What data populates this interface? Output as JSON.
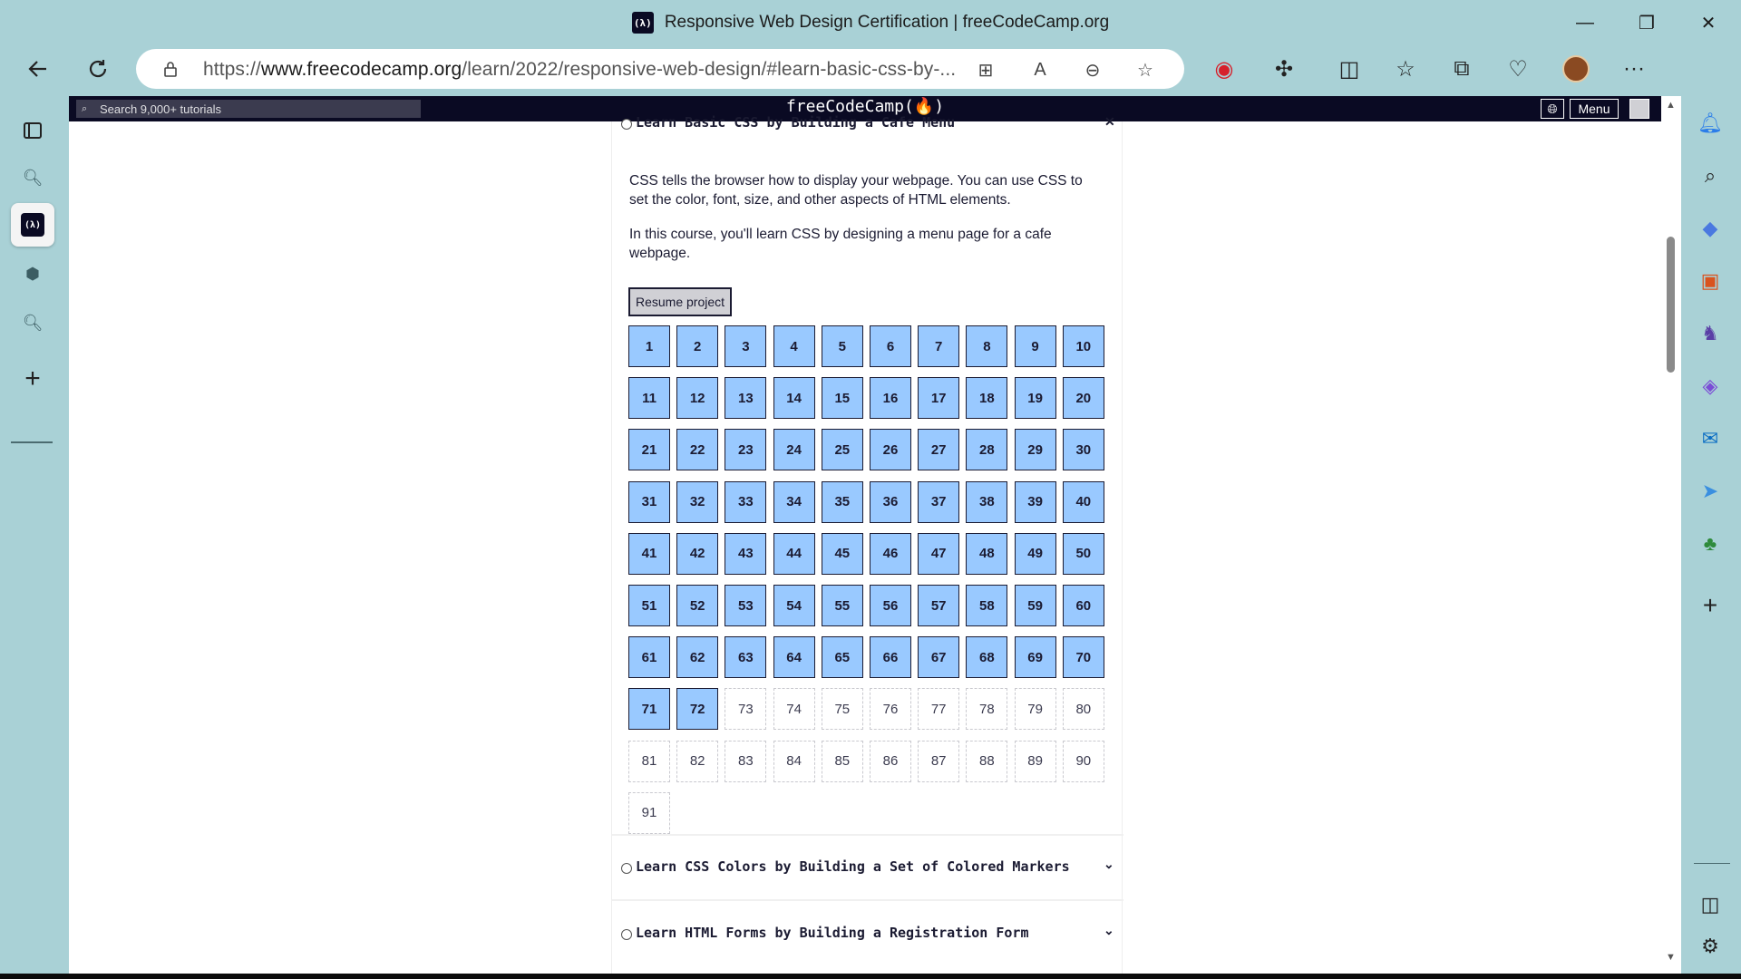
{
  "window": {
    "tab_logo": "(λ)",
    "title": "Responsive Web Design Certification | freeCodeCamp.org"
  },
  "address_bar": {
    "url_prefix": "https://",
    "url_domain": "www.freecodecamp.org",
    "url_path": "/learn/2022/responsive-web-design/#learn-basic-css-by-..."
  },
  "fcc_nav": {
    "search_placeholder": "Search 9,000+ tutorials",
    "brand": "freeCodeCamp(🔥)",
    "menu_label": "Menu"
  },
  "course": {
    "title": "Learn Basic CSS by Building a Cafe Menu",
    "description_1": "CSS tells the browser how to display your webpage. You can use CSS to set the color, font, size, and other aspects of HTML elements.",
    "description_2": "In this course, you'll learn CSS by designing a menu page for a cafe webpage.",
    "resume_label": "Resume project",
    "total_steps": 91,
    "completed_steps": 72
  },
  "next_blocks": [
    {
      "title": "Learn CSS Colors by Building a Set of Colored Markers"
    },
    {
      "title": "Learn HTML Forms by Building a Registration Form"
    }
  ],
  "colors": {
    "completed_step": "#99c9ff",
    "nav_bg": "#0a0a23",
    "browser_frame": "#a9d1d6"
  }
}
